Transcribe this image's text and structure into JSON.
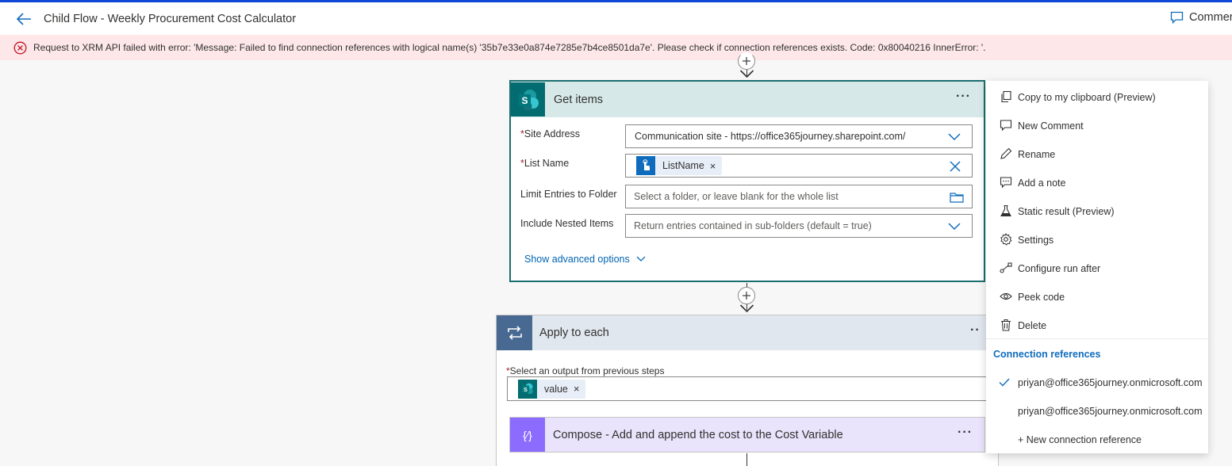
{
  "header": {
    "title": "Child Flow - Weekly Procurement Cost Calculator",
    "comments_label": "Commer"
  },
  "error": {
    "message": "Request to XRM API failed with error: 'Message: Failed to find connection references with logical name(s) '35b7e33e0a874e7285e7b4ce8501da7e'. Please check if connection references exists. Code: 0x80040216 InnerError: '."
  },
  "get_items": {
    "title": "Get items",
    "more": "···",
    "fields": [
      {
        "label": "Site Address",
        "required": "*",
        "value": "Communication site - https://office365journey.sharepoint.com/"
      },
      {
        "label": "List Name",
        "required": "*",
        "token": "ListName",
        "token_close": "×"
      },
      {
        "label": "Limit Entries to Folder",
        "placeholder": "Select a folder, or leave blank for the whole list"
      },
      {
        "label": "Include Nested Items",
        "placeholder": "Return entries contained in sub-folders (default = true)"
      }
    ],
    "advanced": "Show advanced options"
  },
  "apply_each": {
    "title": "Apply to each",
    "more": "··",
    "output_required": "*",
    "output_label": "Select an output from previous steps",
    "token": "value",
    "token_close": "×"
  },
  "compose": {
    "title": "Compose - Add and append the cost to the Cost Variable",
    "more": "···",
    "icon": "{∕}"
  },
  "menu": {
    "items": [
      {
        "label": "Copy to my clipboard (Preview)",
        "icon": "copy-icon"
      },
      {
        "label": "New Comment",
        "icon": "comment-icon"
      },
      {
        "label": "Rename",
        "icon": "pencil-icon"
      },
      {
        "label": "Add a note",
        "icon": "note-icon"
      },
      {
        "label": "Static result (Preview)",
        "icon": "flask-icon"
      },
      {
        "label": "Settings",
        "icon": "gear-icon"
      },
      {
        "label": "Configure run after",
        "icon": "run-after-icon"
      },
      {
        "label": "Peek code",
        "icon": "eye-icon"
      },
      {
        "label": "Delete",
        "icon": "trash-icon"
      }
    ],
    "section_title": "Connection references",
    "connections": [
      {
        "label": "priyan@office365journey.onmicrosoft.com",
        "selected": true
      },
      {
        "label": "priyan@office365journey.onmicrosoft.com",
        "selected": false
      }
    ],
    "new_connection": "+ New connection reference"
  },
  "colors": {
    "accent": "#0f6cbd",
    "error_bg": "#fde7e9",
    "sharepoint": "#036c70",
    "apply_each": "#486991",
    "compose": "#8c6cff"
  }
}
